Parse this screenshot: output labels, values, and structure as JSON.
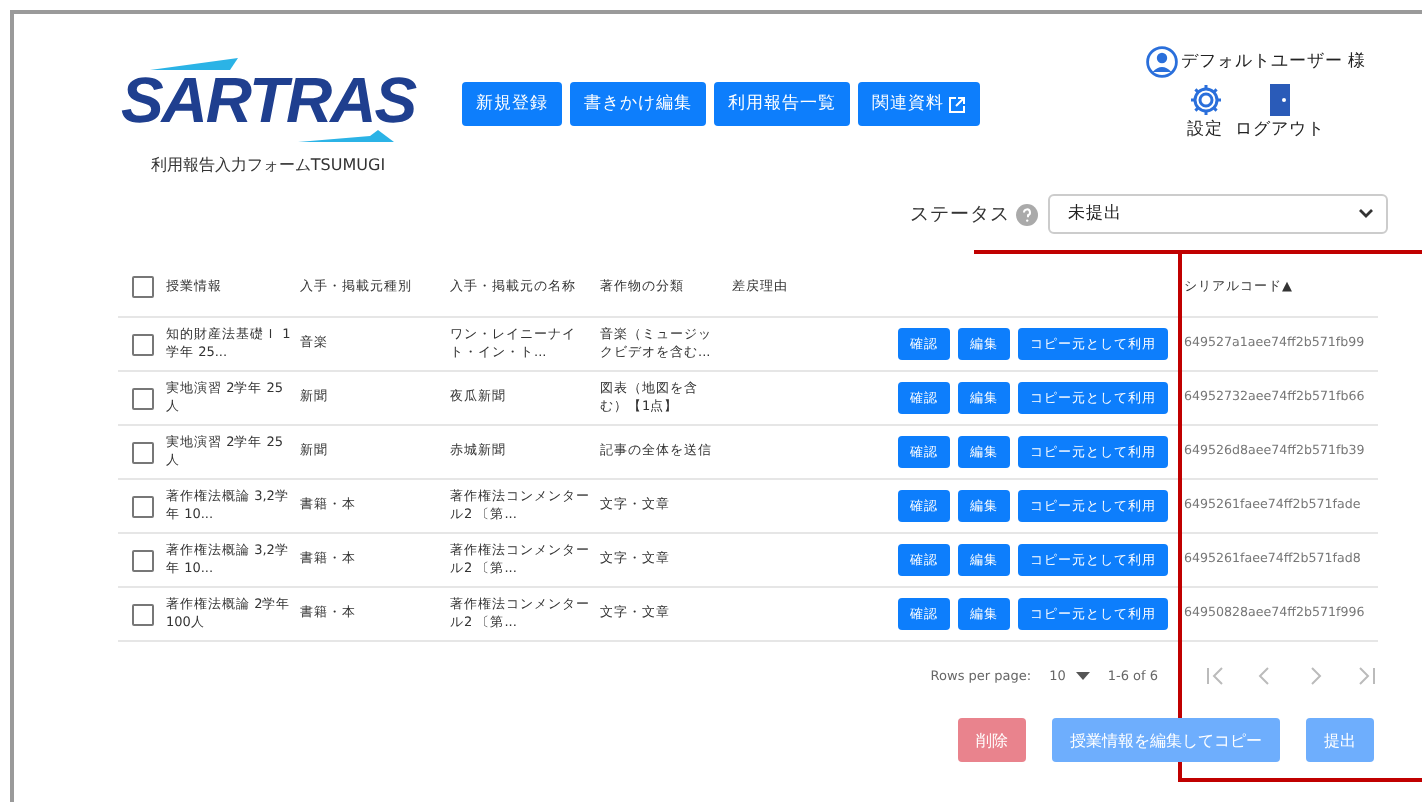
{
  "header": {
    "logo": "SARTRAS",
    "subtitle": "利用報告入力フォームTSUMUGI"
  },
  "nav": [
    {
      "label": "新規登録",
      "external": false
    },
    {
      "label": "書きかけ編集",
      "external": false
    },
    {
      "label": "利用報告一覧",
      "external": false
    },
    {
      "label": "関連資料",
      "external": true
    }
  ],
  "user": {
    "name": "デフォルトユーザー 様",
    "settings": "設定",
    "logout": "ログアウト"
  },
  "status_filter": {
    "label": "ステータス",
    "value": "未提出"
  },
  "table": {
    "header_checked": false,
    "columns": [
      "授業情報",
      "入手・掲載元種別",
      "入手・掲載元の名称",
      "著作物の分類",
      "差戻理由",
      "シリアルコード▲"
    ],
    "rows": [
      {
        "checked": false,
        "cells": [
          "知的財産法基礎Ｉ 1学年 25...",
          "音楽",
          "ワン・レイニーナイト・イン・ト...",
          "音楽（ミュージックビデオを含む...",
          ""
        ],
        "buttons": [
          "確認",
          "編集",
          "コピー元として利用"
        ],
        "serial": "649527a1aee74ff2b571fb99"
      },
      {
        "checked": false,
        "cells": [
          "実地演習 2学年 25人",
          "新聞",
          "夜瓜新聞",
          "図表（地図を含む）【1点】",
          ""
        ],
        "buttons": [
          "確認",
          "編集",
          "コピー元として利用"
        ],
        "serial": "64952732aee74ff2b571fb66"
      },
      {
        "checked": false,
        "cells": [
          "実地演習 2学年 25人",
          "新聞",
          "赤城新聞",
          "記事の全体を送信",
          ""
        ],
        "buttons": [
          "確認",
          "編集",
          "コピー元として利用"
        ],
        "serial": "649526d8aee74ff2b571fb39"
      },
      {
        "checked": false,
        "cells": [
          "著作権法概論 3,2学年 10...",
          "書籍・本",
          "著作権法コンメンタール2 〔第...",
          "文字・文章",
          ""
        ],
        "buttons": [
          "確認",
          "編集",
          "コピー元として利用"
        ],
        "serial": "6495261faee74ff2b571fade"
      },
      {
        "checked": false,
        "cells": [
          "著作権法概論 3,2学年 10...",
          "書籍・本",
          "著作権法コンメンタール2 〔第...",
          "文字・文章",
          ""
        ],
        "buttons": [
          "確認",
          "編集",
          "コピー元として利用"
        ],
        "serial": "6495261faee74ff2b571fad8"
      },
      {
        "checked": false,
        "cells": [
          "著作権法概論 2学年 100人",
          "書籍・本",
          "著作権法コンメンタール2 〔第...",
          "文字・文章",
          ""
        ],
        "buttons": [
          "確認",
          "編集",
          "コピー元として利用"
        ],
        "serial": "64950828aee74ff2b571f996"
      }
    ]
  },
  "pagination": {
    "rows_label": "Rows per page:",
    "rows_value": "10",
    "range": "1-6 of 6"
  },
  "actions": [
    {
      "label": "削除",
      "kind": "danger",
      "disabled": true
    },
    {
      "label": "授業情報を編集してコピー",
      "kind": "primary",
      "disabled": true
    },
    {
      "label": "提出",
      "kind": "primary",
      "disabled": true
    }
  ]
}
